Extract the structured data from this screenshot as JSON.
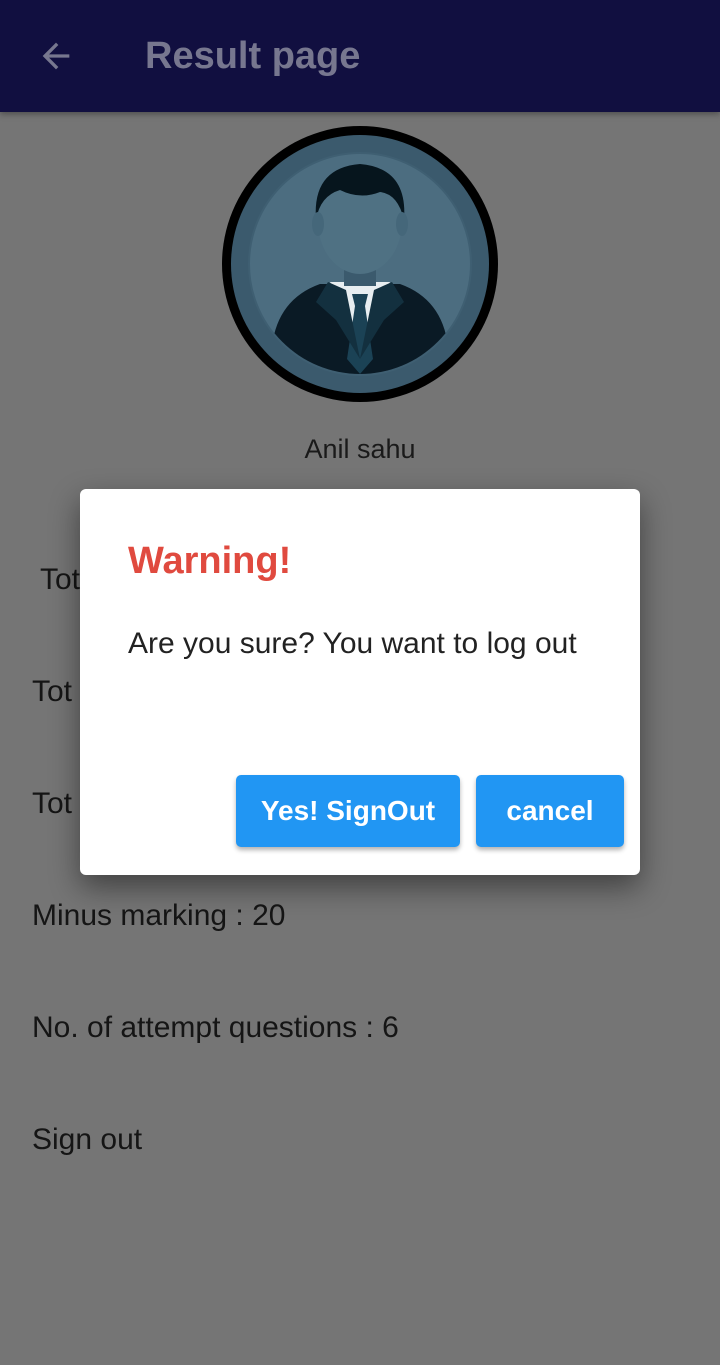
{
  "appbar": {
    "title": "Result page",
    "back_icon": "arrow-left-icon",
    "background": "#110f40"
  },
  "profile": {
    "avatar_icon": "user-avatar-icon",
    "name": "Anil sahu"
  },
  "stats": {
    "row1_fragment": "Tot",
    "row2_fragment": "Tot",
    "row3_fragment": "Tot",
    "minus_marking": "Minus marking : 20",
    "attempted": "No. of attempt questions : 6"
  },
  "signout_label": "Sign out",
  "dialog": {
    "title": "Warning!",
    "title_color": "#e04a3f",
    "message": "Are you sure? You want to log out",
    "confirm_label": "Yes! SignOut",
    "cancel_label": "cancel",
    "button_color": "#2196f3"
  }
}
